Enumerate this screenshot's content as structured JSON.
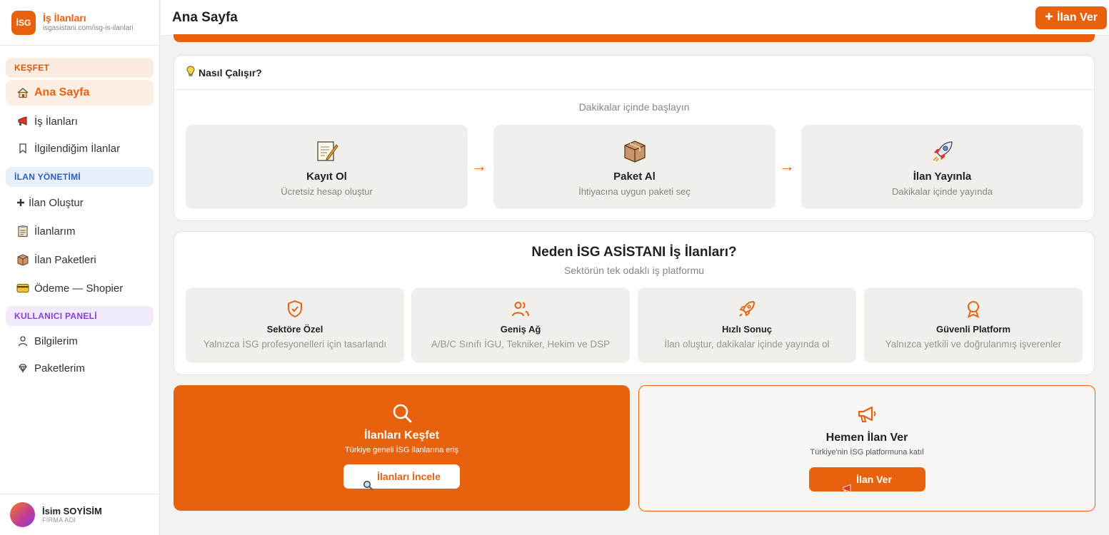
{
  "brand": {
    "logo_text": "İSG",
    "title": "İş İlanları",
    "url": "isgasistani.com/isg-is-ilanlari"
  },
  "sidebar": {
    "sections": [
      {
        "label": "KEŞFET"
      },
      {
        "label": "İLAN YÖNETİMİ"
      },
      {
        "label": "KULLANICI PANELİ"
      }
    ],
    "items": [
      {
        "label": "Ana Sayfa",
        "icon": "house-icon"
      },
      {
        "label": "İş İlanları",
        "icon": "megaphone-icon"
      },
      {
        "label": "İlgilendiğim İlanlar",
        "icon": "bookmark-icon"
      },
      {
        "label": "İlan Oluştur",
        "icon": "plus-icon"
      },
      {
        "label": "İlanlarım",
        "icon": "clipboard-icon"
      },
      {
        "label": "İlan Paketleri",
        "icon": "package-icon"
      },
      {
        "label": "Ödeme — Shopier",
        "icon": "credit-card-icon"
      },
      {
        "label": "Bilgilerim",
        "icon": "user-icon"
      },
      {
        "label": "Paketlerim",
        "icon": "diamond-icon"
      }
    ]
  },
  "user": {
    "name": "İsim SOYİSİM",
    "company": "FİRMA ADI"
  },
  "header": {
    "title": "Ana Sayfa",
    "action_label": "İlan Ver"
  },
  "how": {
    "title": "Nasıl Çalışır?",
    "subtitle": "Dakikalar içinde başlayın",
    "steps": [
      {
        "title": "Kayıt Ol",
        "desc": "Ücretsiz hesap oluştur",
        "icon": "memo-icon"
      },
      {
        "title": "Paket Al",
        "desc": "İhtiyacına uygun paketi seç",
        "icon": "package-icon"
      },
      {
        "title": "İlan Yayınla",
        "desc": "Dakikalar içinde yayında",
        "icon": "rocket-icon"
      }
    ],
    "arrow": "→"
  },
  "why": {
    "title": "Neden İSG ASİSTANI İş İlanları?",
    "subtitle": "Sektörün tek odaklı iş platformu",
    "features": [
      {
        "title": "Sektöre Özel",
        "desc": "Yalnızca İSG profesyonelleri için tasarlandı",
        "icon": "shield-check-icon"
      },
      {
        "title": "Geniş Ağ",
        "desc": "A/B/C Sınıfı İGU, Tekniker, Hekim ve DSP",
        "icon": "users-icon"
      },
      {
        "title": "Hızlı Sonuç",
        "desc": "İlan oluştur, dakikalar içinde yayında ol",
        "icon": "rocket-icon"
      },
      {
        "title": "Güvenli Platform",
        "desc": "Yalnızca yetkili ve doğrulanmış işverenler",
        "icon": "award-icon"
      }
    ]
  },
  "cta": {
    "explore": {
      "title": "İlanları Keşfet",
      "desc": "Türkiye geneli İSG ilanlarına eriş",
      "button": "İlanları İncele"
    },
    "post": {
      "title": "Hemen İlan Ver",
      "desc": "Türkiye'nin İSG platformuna katıl",
      "button": "İlan Ver"
    }
  },
  "colors": {
    "accent": "#e8610f"
  }
}
